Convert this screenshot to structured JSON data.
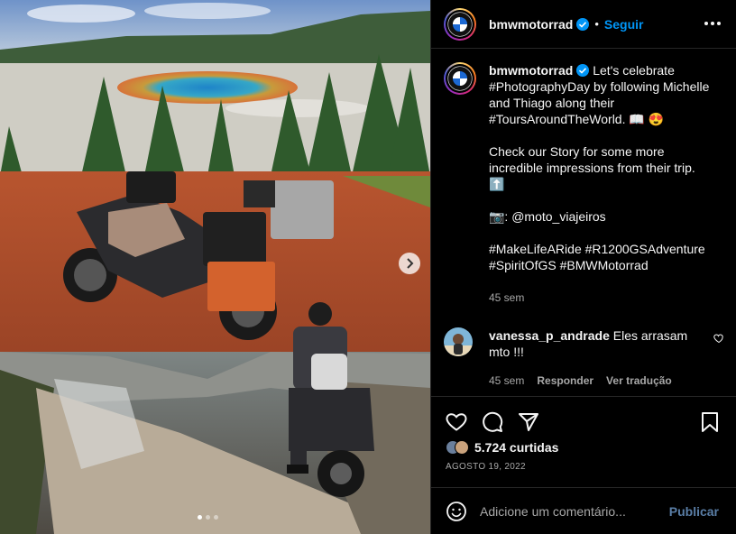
{
  "post": {
    "username": "bmwmotorrad",
    "follow_label": "Seguir",
    "separator": "•",
    "media": {
      "carousel_count": 3,
      "carousel_active_index": 0
    }
  },
  "caption": {
    "username": "bmwmotorrad",
    "p1": "Let's celebrate #PhotographyDay by following Michelle and Thiago along their #ToursAroundTheWorld. 📖 😍",
    "p2": "Check our Story for some more incredible impressions from their trip. ⬆️",
    "p3": "📷: @moto_viajeiros",
    "p4": "#MakeLifeARide #R1200GSAdventure #SpiritOfGS #BMWMotorrad",
    "time": "45 sem"
  },
  "comments": [
    {
      "username": "vanessa_p_andrade",
      "text": "Eles arrasam mto !!!",
      "time": "45 sem",
      "reply_label": "Responder",
      "translate_label": "Ver tradução"
    }
  ],
  "actions": {
    "likes": "5.724 curtidas",
    "date": "AGOSTO 19, 2022"
  },
  "add_comment": {
    "placeholder": "Adicione um comentário...",
    "publish_label": "Publicar"
  },
  "colors": {
    "accent": "#0095f6",
    "publish_disabled": "#5a7ea6",
    "background": "#000000",
    "secondary_text": "#a8a8a8",
    "divider": "#262626"
  },
  "icons": [
    "bmw-logo",
    "verified-icon",
    "more-icon",
    "chevron-right-icon",
    "heart-icon",
    "comment-icon",
    "share-icon",
    "bookmark-icon",
    "emoji-icon"
  ]
}
